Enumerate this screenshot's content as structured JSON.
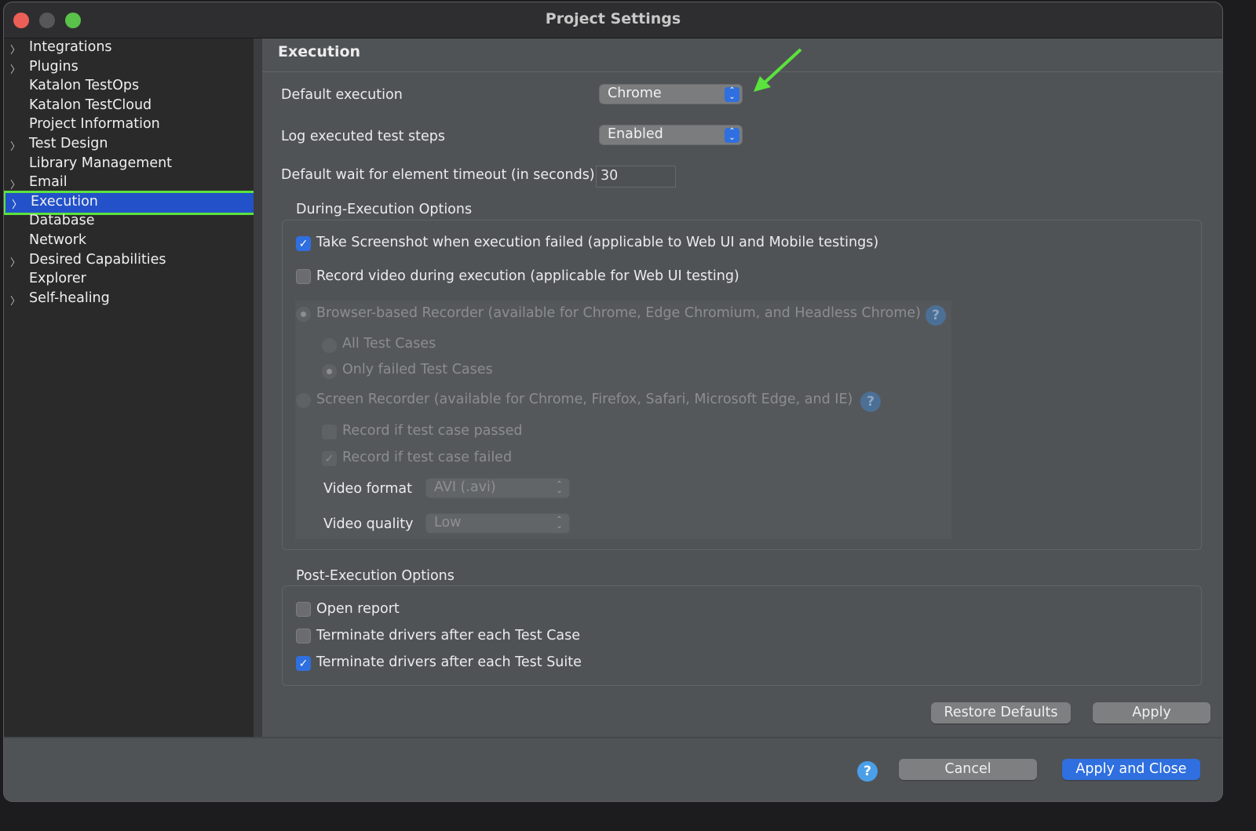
{
  "window": {
    "title": "Project Settings"
  },
  "sidebar": {
    "items": [
      {
        "label": "Integrations",
        "expandable": true
      },
      {
        "label": "Plugins",
        "expandable": true
      },
      {
        "label": "Katalon TestOps",
        "expandable": false
      },
      {
        "label": "Katalon TestCloud",
        "expandable": false
      },
      {
        "label": "Project Information",
        "expandable": false
      },
      {
        "label": "Test Design",
        "expandable": true
      },
      {
        "label": "Library Management",
        "expandable": false
      },
      {
        "label": "Email",
        "expandable": true
      },
      {
        "label": "Execution",
        "expandable": true,
        "selected": true
      },
      {
        "label": "Database",
        "expandable": false
      },
      {
        "label": "Network",
        "expandable": false
      },
      {
        "label": "Desired Capabilities",
        "expandable": true
      },
      {
        "label": "Explorer",
        "expandable": false
      },
      {
        "label": "Self-healing",
        "expandable": true
      }
    ]
  },
  "main": {
    "heading": "Execution",
    "default_execution": {
      "label": "Default execution",
      "value": "Chrome"
    },
    "log_steps": {
      "label": "Log executed test steps",
      "value": "Enabled"
    },
    "timeout": {
      "label": "Default wait for element timeout (in seconds)",
      "value": "30"
    },
    "during": {
      "title": "During-Execution Options",
      "take_screenshot": {
        "label": "Take Screenshot when execution failed (applicable to Web UI and Mobile testings)",
        "checked": true
      },
      "record_video": {
        "label": "Record video during execution (applicable for Web UI testing)",
        "checked": false
      },
      "browser_recorder": {
        "label": "Browser-based Recorder (available for Chrome, Edge Chromium, and Headless Chrome)",
        "selected": true
      },
      "all_cases": {
        "label": "All Test Cases",
        "selected": false
      },
      "only_failed": {
        "label": "Only failed Test Cases",
        "selected": true
      },
      "screen_recorder": {
        "label": "Screen Recorder (available for Chrome, Firefox, Safari, Microsoft Edge, and IE)",
        "selected": false
      },
      "record_passed": {
        "label": "Record if test case passed",
        "checked": false
      },
      "record_failed": {
        "label": "Record if test case failed",
        "checked": true
      },
      "video_format": {
        "label": "Video format",
        "value": "AVI (.avi)"
      },
      "video_quality": {
        "label": "Video quality",
        "value": "Low"
      }
    },
    "post": {
      "title": "Post-Execution Options",
      "open_report": {
        "label": "Open report",
        "checked": false
      },
      "terminate_case": {
        "label": "Terminate drivers after each Test Case",
        "checked": false
      },
      "terminate_suite": {
        "label": "Terminate drivers after each Test Suite",
        "checked": true
      }
    },
    "restore_defaults": "Restore Defaults",
    "apply": "Apply"
  },
  "footer": {
    "cancel": "Cancel",
    "apply_close": "Apply and Close",
    "help": "?"
  },
  "icons": {
    "help": "?",
    "check": "✓",
    "chevron": "›",
    "updown": "⌃⌄"
  },
  "colors": {
    "accent": "#2f6fdf",
    "annotation": "#5be33d"
  }
}
